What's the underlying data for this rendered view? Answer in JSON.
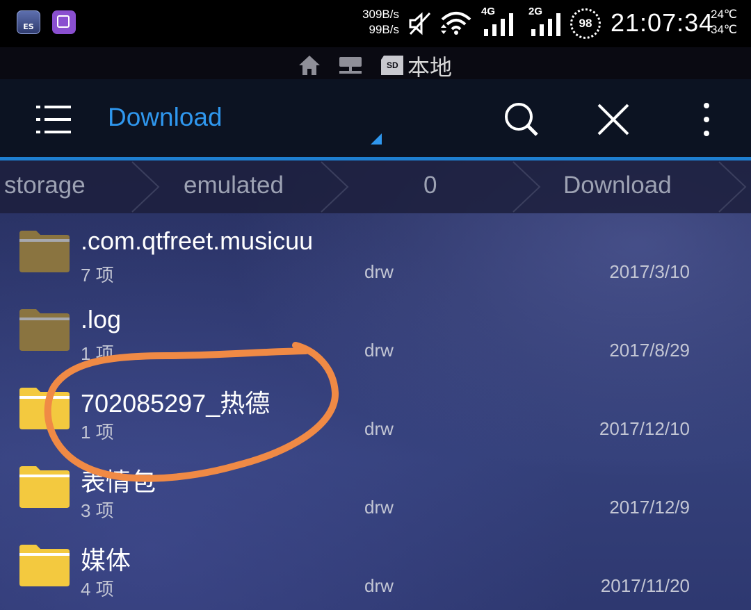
{
  "status_bar": {
    "net_up": "309B/s",
    "net_down": "99B/s",
    "signal_4g": "4G",
    "signal_2g": "2G",
    "battery": "98",
    "time": "21:07:34",
    "temp_1": "24℃",
    "temp_2": "34℃",
    "icons": [
      "es-file-explorer-app-icon",
      "gallery-app-icon",
      "mute-icon",
      "wifi-icon",
      "signal-4g-icon",
      "signal-2g-icon",
      "battery-icon"
    ]
  },
  "location_bar": {
    "label": "本地",
    "icons": [
      "home-icon",
      "network-icon",
      "sd-card-icon"
    ]
  },
  "toolbar": {
    "title": "Download",
    "icons": [
      "menu-icon",
      "search-icon",
      "close-icon",
      "more-vert-icon"
    ]
  },
  "breadcrumb": [
    "storage",
    "emulated",
    "0",
    "Download"
  ],
  "files": [
    {
      "name": ".com.qtfreet.musicuu",
      "count": "7 项",
      "perm": "drw",
      "date": "2017/3/10",
      "hidden": true
    },
    {
      "name": ".log",
      "count": "1 项",
      "perm": "drw",
      "date": "2017/8/29",
      "hidden": true
    },
    {
      "name": "702085297_热德",
      "count": "1 项",
      "perm": "drw",
      "date": "2017/12/10",
      "hidden": false
    },
    {
      "name": "表情包",
      "count": "3 项",
      "perm": "drw",
      "date": "2017/12/9",
      "hidden": false
    },
    {
      "name": "媒体",
      "count": "4 项",
      "perm": "drw",
      "date": "2017/11/20",
      "hidden": false
    }
  ],
  "colors": {
    "accent": "#2f97ee",
    "folder_hidden": "#8a7440",
    "folder": "#f3c93f",
    "annotation": "#f08a45"
  }
}
